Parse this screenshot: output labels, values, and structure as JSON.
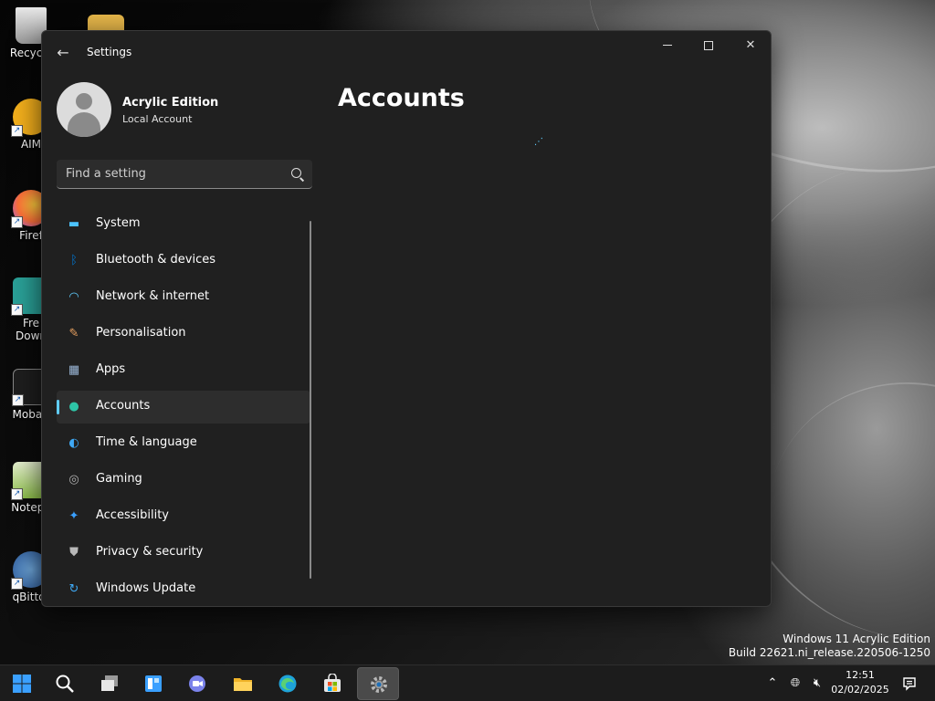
{
  "desktop": {
    "icons": [
      {
        "label": "Recycle",
        "icon": "recycle-bin-icon"
      },
      {
        "label": "AIM",
        "icon": "aimp-icon"
      },
      {
        "label": "Firef",
        "icon": "firefox-icon"
      },
      {
        "label": "Free Down",
        "line1": "Fre",
        "line2": "Down",
        "icon": "free-download-manager-icon"
      },
      {
        "label": "MobaX",
        "icon": "mobaxterm-icon"
      },
      {
        "label": "Notepa",
        "icon": "notepad-plus-plus-icon"
      },
      {
        "label": "qBittor",
        "icon": "qbittorrent-icon"
      }
    ]
  },
  "window": {
    "title": "Settings",
    "back_icon": "back-arrow-icon",
    "profile": {
      "name": "Acrylic Edition",
      "type": "Local Account"
    },
    "search": {
      "placeholder": "Find a setting",
      "value": ""
    },
    "nav": [
      {
        "label": "System",
        "icon": "system-icon",
        "color": "#4cc2ff"
      },
      {
        "label": "Bluetooth & devices",
        "icon": "bluetooth-icon",
        "color": "#0078d4"
      },
      {
        "label": "Network & internet",
        "icon": "wifi-icon",
        "color": "#60cdff"
      },
      {
        "label": "Personalisation",
        "icon": "brush-icon",
        "color": "#e8a060"
      },
      {
        "label": "Apps",
        "icon": "apps-icon",
        "color": "#9ab6d6"
      },
      {
        "label": "Accounts",
        "icon": "person-icon",
        "color": "#2ec5a7",
        "selected": true
      },
      {
        "label": "Time & language",
        "icon": "globe-clock-icon",
        "color": "#3fa9f5"
      },
      {
        "label": "Gaming",
        "icon": "gamepad-icon",
        "color": "#b0b0b0"
      },
      {
        "label": "Accessibility",
        "icon": "accessibility-icon",
        "color": "#3aa0ff"
      },
      {
        "label": "Privacy & security",
        "icon": "shield-icon",
        "color": "#b8b8b8"
      },
      {
        "label": "Windows Update",
        "icon": "update-icon",
        "color": "#3fa9f5"
      }
    ],
    "page_title": "Accounts"
  },
  "watermark": {
    "line1": "Windows 11 Acrylic Edition",
    "line2": "Build 22621.ni_release.220506-1250"
  },
  "taskbar": {
    "apps": [
      {
        "name": "start-button",
        "icon": "windows-logo-icon"
      },
      {
        "name": "search-button",
        "icon": "search-icon"
      },
      {
        "name": "task-view-button",
        "icon": "task-view-icon"
      },
      {
        "name": "widgets-button",
        "icon": "widgets-icon"
      },
      {
        "name": "chat-button",
        "icon": "chat-icon"
      },
      {
        "name": "file-explorer-button",
        "icon": "folder-icon"
      },
      {
        "name": "edge-button",
        "icon": "edge-icon"
      },
      {
        "name": "store-button",
        "icon": "store-icon"
      },
      {
        "name": "settings-button",
        "icon": "gear-icon",
        "active": true
      }
    ],
    "tray": {
      "time": "12:51",
      "date": "02/02/2025"
    }
  },
  "colors": {
    "accent": "#60cdff",
    "window_bg": "#202020",
    "taskbar_bg": "#1c1c1c"
  }
}
